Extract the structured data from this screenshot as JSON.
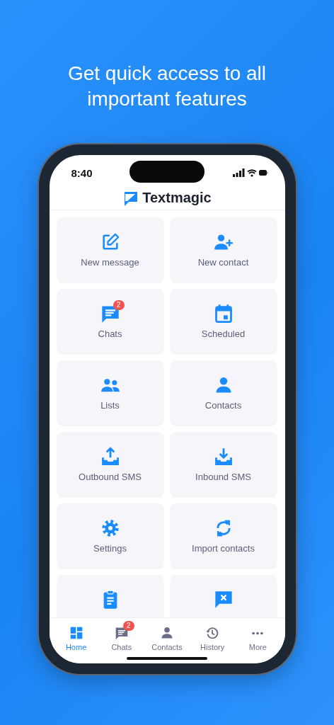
{
  "headline": "Get quick access to all important features",
  "status_bar": {
    "time": "8:40"
  },
  "app": {
    "name": "Textmagic"
  },
  "tiles": [
    {
      "kind": "compose",
      "label": "New message"
    },
    {
      "kind": "add-person",
      "label": "New contact"
    },
    {
      "kind": "chat",
      "label": "Chats",
      "badge": "2"
    },
    {
      "kind": "calendar",
      "label": "Scheduled"
    },
    {
      "kind": "people",
      "label": "Lists"
    },
    {
      "kind": "person",
      "label": "Contacts"
    },
    {
      "kind": "upload",
      "label": "Outbound SMS"
    },
    {
      "kind": "download",
      "label": "Inbound SMS"
    },
    {
      "kind": "gear",
      "label": "Settings"
    },
    {
      "kind": "sync",
      "label": "Import contacts"
    },
    {
      "kind": "clipboard"
    },
    {
      "kind": "closed-chat"
    }
  ],
  "tab_bar": [
    {
      "kind": "grid",
      "label": "Home",
      "selected": true
    },
    {
      "kind": "chat",
      "label": "Chats",
      "selected": false,
      "badge": "2"
    },
    {
      "kind": "person",
      "label": "Contacts",
      "selected": false
    },
    {
      "kind": "history",
      "label": "History",
      "selected": false
    },
    {
      "kind": "dots",
      "label": "More",
      "selected": false
    }
  ]
}
